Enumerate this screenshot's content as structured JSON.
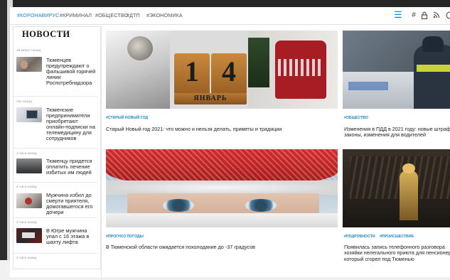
{
  "nav": {
    "tags": [
      "#КОРОНАВИРУС",
      "#КРИМИНАЛ",
      "#ОБЩЕСТВО",
      "#ДТП",
      "#ЭКОНОМИКА"
    ],
    "icons": [
      "menu-icon",
      "hash-icon",
      "lock-icon",
      "rss-icon",
      "search-icon"
    ]
  },
  "sidebar": {
    "title": "НОВОСТИ",
    "items": [
      {
        "time": "29 минут назад",
        "text": "Тюменцев предупреждают о фальшивой горячей линии Роспотребнадзора"
      },
      {
        "time": "час назад",
        "text": "Тюменские предприниматели приобретают онлайн-подписки на телемедицину для сотрудников"
      },
      {
        "time": "3 часа назад",
        "text": "Тюменцу придется оплатить лечение избитых им людей"
      },
      {
        "time": "4 часа назад",
        "text": "Мужчина избил до смерти приятеля, домогавшегося его дочери"
      },
      {
        "time": "4 часа назад",
        "text": "В Югре мужчина упал с 16 этажа в шахту лифта"
      },
      {
        "time": "4 часа назад",
        "text": ""
      }
    ]
  },
  "cards": [
    {
      "tag": "#СТАРЫЙ НОВЫЙ ГОД",
      "title": "Старый Новый год 2021: что можно и нельзя делать, приметы и традиции",
      "img_digits": [
        "1",
        "4"
      ],
      "img_caption": "ЯНВАРЬ"
    },
    {
      "tag": "#ОБЩЕСТВО",
      "title": "Изменения в ПДД в 2021 году: новые штраф законы, изменения для водителей"
    },
    {
      "tag": "#ПРОГНОЗ ПОГОДЫ",
      "title": "В Тюменской области ожидается похолодание до -37 градусов"
    },
    {
      "tags": [
        "#ПОДРОБНОСТИ",
        "#ПРОИСШЕСТВИЕ"
      ],
      "title": "Появилась запись телефонного разговора хозяйки нелегального приюта для пенсионеров, который сгорел под Тюменью"
    }
  ],
  "colors": {
    "accent": "#1e88c9",
    "text": "#222222",
    "muted": "#999999"
  }
}
